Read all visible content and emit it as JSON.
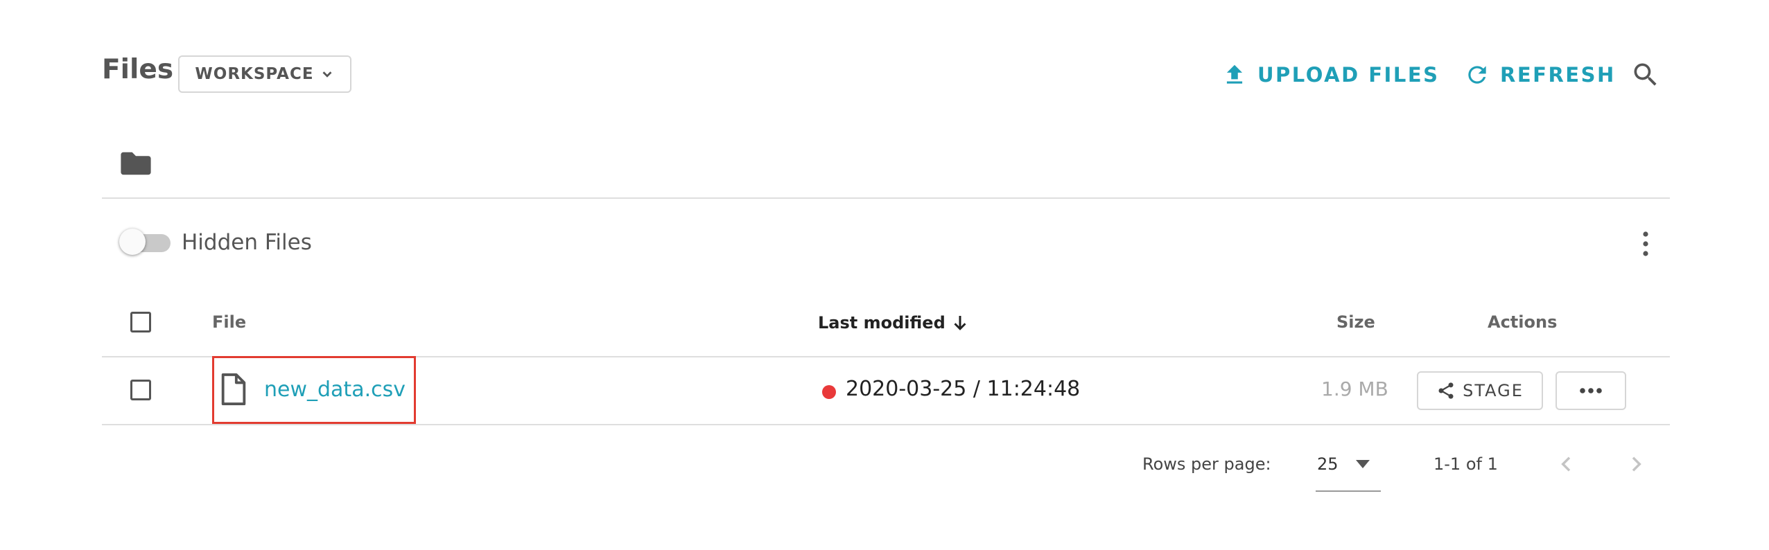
{
  "header": {
    "title": "Files",
    "workspace_label": "WORKSPACE",
    "upload_label": "UPLOAD FILES",
    "refresh_label": "REFRESH"
  },
  "toolbar": {
    "hidden_files_label": "Hidden Files",
    "hidden_files_enabled": false
  },
  "table": {
    "columns": {
      "file": "File",
      "last_modified": "Last modified",
      "size": "Size",
      "actions": "Actions"
    },
    "rows": [
      {
        "name": "new_data.csv",
        "modified": "2020-03-25 / 11:24:48",
        "size": "1.9 MB",
        "status_color": "#e9393a",
        "stage_label": "STAGE"
      }
    ]
  },
  "pagination": {
    "rows_per_page_label": "Rows per page:",
    "rows_per_page": "25",
    "range": "1-1 of 1"
  },
  "colors": {
    "accent": "#1f9fb7",
    "highlight_border": "#e23b30"
  }
}
